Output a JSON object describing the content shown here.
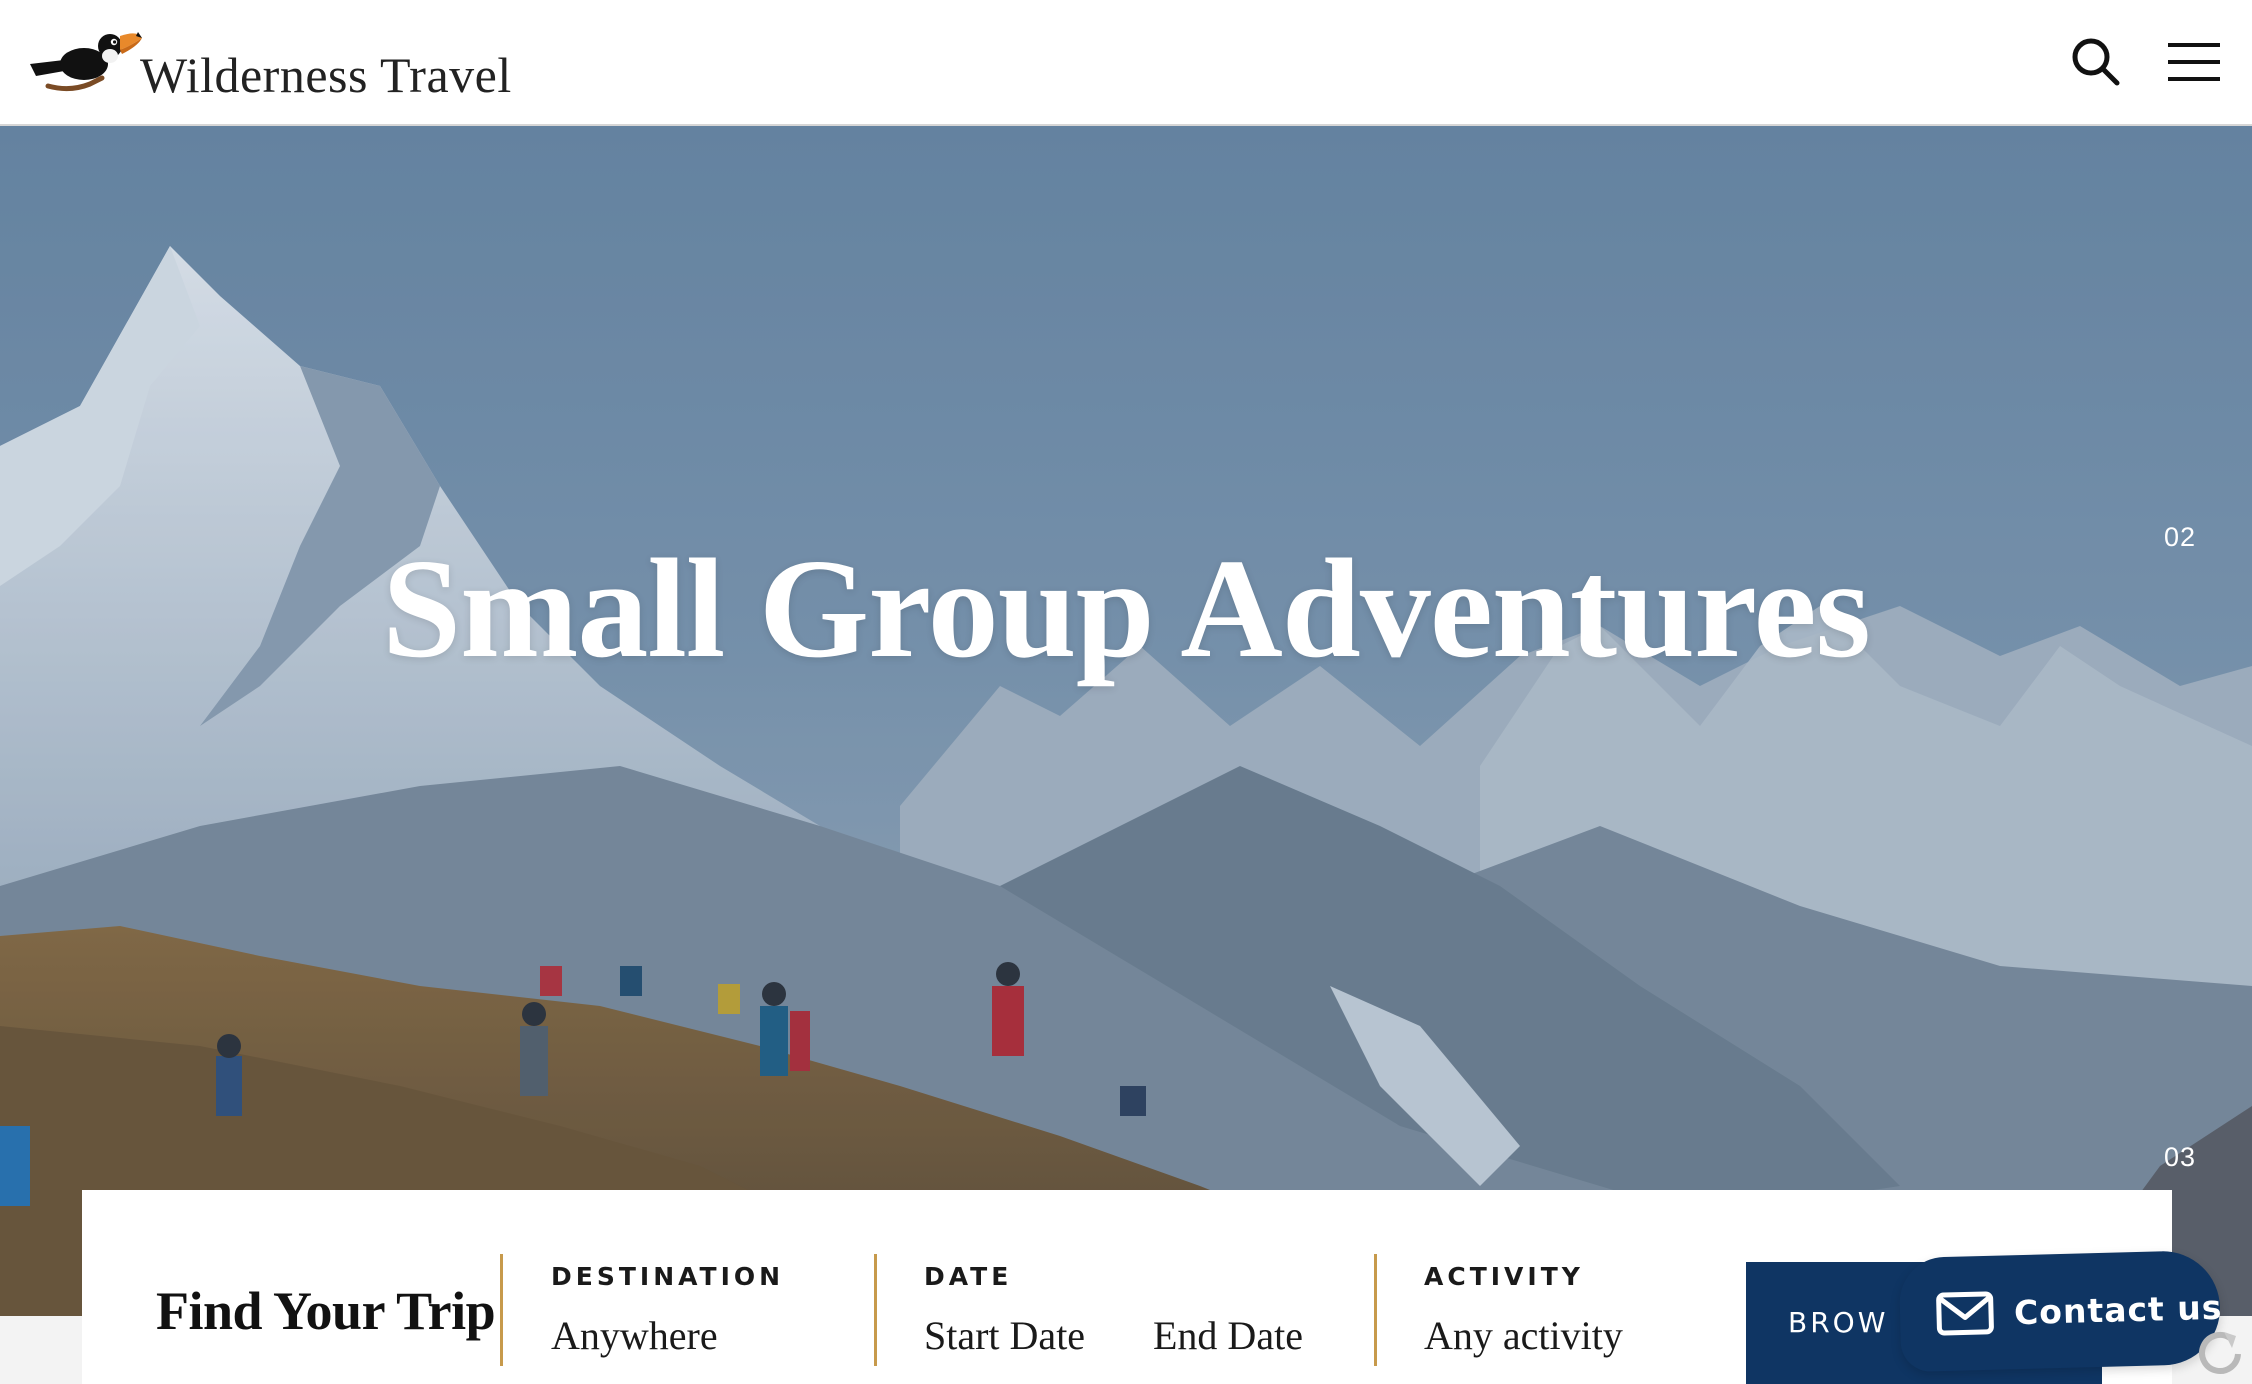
{
  "header": {
    "brand_name": "Wilderness Travel",
    "logo_icon": "toucan-logo-icon",
    "search_icon": "search-icon",
    "menu_icon": "hamburger-menu-icon"
  },
  "hero": {
    "title": "Small Group Adventures",
    "slide_numbers": [
      "02",
      "03"
    ]
  },
  "trip_search": {
    "title": "Find Your Trip",
    "destination": {
      "label": "DESTINATION",
      "value": "Anywhere"
    },
    "date": {
      "label": "DATE",
      "start_placeholder": "Start Date",
      "end_placeholder": "End Date"
    },
    "activity": {
      "label": "ACTIVITY",
      "value": "Any activity"
    },
    "browse_label": "BROW"
  },
  "contact": {
    "label": "Contact us",
    "icon": "envelope-icon"
  },
  "colors": {
    "brand_navy": "#0f3563",
    "accent_gold": "#c79a4b",
    "header_bg": "#ffffff",
    "hero_text": "#ffffff"
  }
}
